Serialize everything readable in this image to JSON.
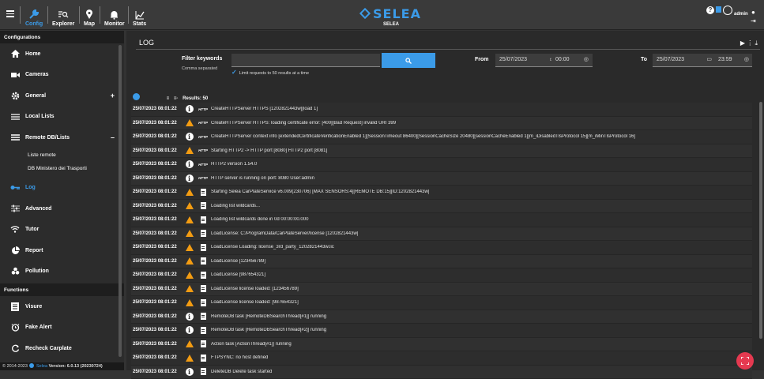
{
  "topbar": {
    "nav": [
      {
        "label": "Config",
        "icon": "wrench-icon"
      },
      {
        "label": "Explorer",
        "icon": "list-search-icon"
      },
      {
        "label": "Map",
        "icon": "map-pin-icon"
      },
      {
        "label": "Monitor",
        "icon": "bell-icon"
      },
      {
        "label": "Stats",
        "icon": "chart-icon"
      }
    ],
    "brand": "SELEA",
    "brand_sub": "SELEA",
    "user": "admin",
    "accent": "#3b9be8"
  },
  "sidebar": {
    "section1": "Configurations",
    "items": [
      {
        "label": "Home",
        "icon": "home-icon"
      },
      {
        "label": "Cameras",
        "icon": "camera-icon"
      },
      {
        "label": "General",
        "icon": "gear-icon",
        "toggle": "+"
      },
      {
        "label": "Local Lists",
        "icon": "list-icon"
      },
      {
        "label": "Remote DB/Lists",
        "icon": "list-icon",
        "toggle": "–"
      },
      {
        "label": "Liste remote",
        "sub": true
      },
      {
        "label": "DB Ministero dei Trasporti",
        "sub": true
      },
      {
        "label": "Log",
        "icon": "key-icon",
        "active": true
      },
      {
        "label": "Advanced",
        "icon": "sliders-icon"
      },
      {
        "label": "Tutor",
        "icon": "wifi-icon"
      },
      {
        "label": "Report",
        "icon": "pie-icon"
      },
      {
        "label": "Pollution",
        "icon": "biohazard-icon"
      }
    ],
    "section2": "Functions",
    "functions": [
      {
        "label": "Visure",
        "icon": "doc-icon"
      },
      {
        "label": "Fake Alert",
        "icon": "clock-icon"
      },
      {
        "label": "Recheck Carplate",
        "icon": "refresh-icon"
      }
    ],
    "footer_pre": "© 2014-2023",
    "footer_brand": "Selea",
    "footer_version": "Version: 6.0.13 (20230724)"
  },
  "main": {
    "title": "LOG",
    "filter_label": "Filter keywords",
    "filter_sub": "Comma separated",
    "filter_value": "",
    "limit_label": "Limit requests to 50 results at a time",
    "from_label": "From",
    "from_date": "25/07/2023",
    "from_time": "00:00",
    "to_label": "To",
    "to_date": "25/07/2023",
    "to_time": "23:59",
    "results_label": "Results: 50"
  },
  "rows": [
    {
      "ts": "25/07/2023 08:01:22",
      "level": "info",
      "src": "HTTP",
      "msg": "CreateHTTPServer HTTPS [1202821443w][load 1]"
    },
    {
      "ts": "25/07/2023 08:01:22",
      "level": "warn",
      "src": "HTTP",
      "msg": "CreateHTTPServer HTTPS: loading certificate error: [400][Bad Request] invalid URI 399"
    },
    {
      "ts": "25/07/2023 08:01:22",
      "level": "info",
      "src": "HTTP",
      "msg": "CreateHTTPServer context info [extendedCertificateVerificationEnabled 1][SessionTimeout 86400][SessionCacheSize 20480][sessionCacheEnabled 1][m_iDisabledTlsProtocol 15][m_iMinTlsProtocol 16]"
    },
    {
      "ts": "25/07/2023 08:01:22",
      "level": "warn",
      "src": "HTTP",
      "msg": "Starting HTTP2 -> HTTP port [8080] HTTP2 port [8081]"
    },
    {
      "ts": "25/07/2023 08:01:22",
      "level": "info",
      "src": "HTTP",
      "msg": "HTTP2 version 1.54.0"
    },
    {
      "ts": "25/07/2023 08:01:22",
      "level": "info",
      "src": "HTTP",
      "msg": "HTTP server is running on port: 8080 User:admin"
    },
    {
      "ts": "25/07/2023 08:01:22",
      "level": "warn",
      "src": "doc",
      "msg": "Starting Selea CarPlateService v6.009(230706) [MAX SENSORS:4][REMOTE DB:15][ID:1202821443w]"
    },
    {
      "ts": "25/07/2023 08:01:22",
      "level": "warn",
      "src": "doc",
      "msg": "Loading list wildcards..."
    },
    {
      "ts": "25/07/2023 08:01:22",
      "level": "warn",
      "src": "doc",
      "msg": "Loading list wildcards done in 0d 00:00:00.000"
    },
    {
      "ts": "25/07/2023 08:01:22",
      "level": "warn",
      "src": "doc",
      "msg": "LoadLicense: C:/ProgramData/CarPlateServer/license [1202821443w]"
    },
    {
      "ts": "25/07/2023 08:01:22",
      "level": "warn",
      "src": "doc",
      "msg": "LoadLicense Loading: license_3rd_party_1202821443w.lic"
    },
    {
      "ts": "25/07/2023 08:01:22",
      "level": "warn",
      "src": "doc",
      "msg": "LoadLicense [123456789]"
    },
    {
      "ts": "25/07/2023 08:01:22",
      "level": "warn",
      "src": "doc",
      "msg": "LoadLicense [987654321]"
    },
    {
      "ts": "25/07/2023 08:01:22",
      "level": "warn",
      "src": "doc",
      "msg": "LoadLicense license loaded: [123456789]"
    },
    {
      "ts": "25/07/2023 08:01:22",
      "level": "warn",
      "src": "doc",
      "msg": "LoadLicense license loaded: [987654321]"
    },
    {
      "ts": "25/07/2023 08:01:22",
      "level": "info",
      "src": "doc",
      "msg": "RemoteDB task [RemoteDBSearchThread[#1]] running"
    },
    {
      "ts": "25/07/2023 08:01:22",
      "level": "info",
      "src": "doc",
      "msg": "RemoteDB task [RemoteDBSearchThread[#2]] running"
    },
    {
      "ts": "25/07/2023 08:01:22",
      "level": "warn",
      "src": "doc",
      "msg": "Action task [ActionThread[#1]] running"
    },
    {
      "ts": "25/07/2023 08:01:22",
      "level": "warn",
      "src": "doc",
      "msg": "FTPSYNC: no host defined"
    },
    {
      "ts": "25/07/2023 08:01:22",
      "level": "info",
      "src": "doc",
      "msg": "DeleteDB Delete task started"
    }
  ]
}
